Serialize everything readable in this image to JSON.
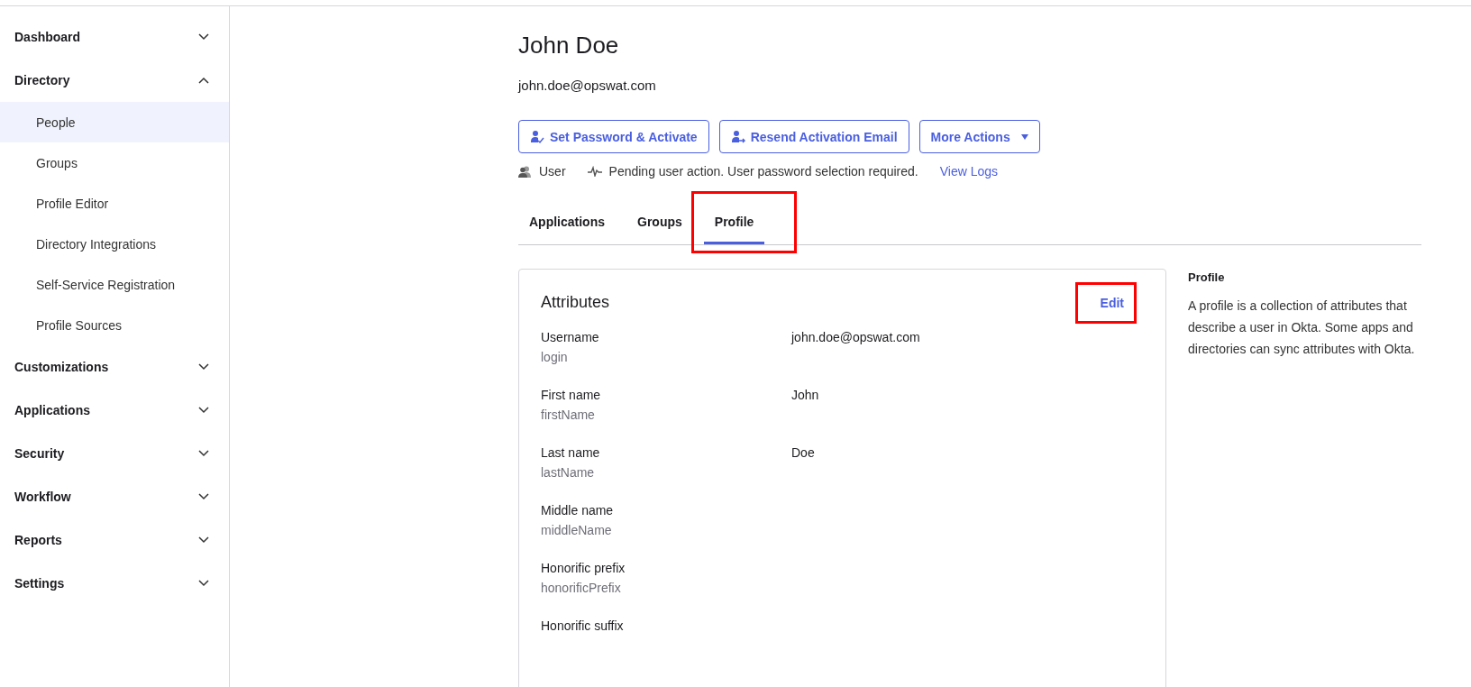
{
  "sidebar": {
    "items": [
      {
        "label": "Dashboard",
        "expanded": false
      },
      {
        "label": "Directory",
        "expanded": true,
        "children": [
          {
            "label": "People",
            "selected": true
          },
          {
            "label": "Groups",
            "selected": false
          },
          {
            "label": "Profile Editor",
            "selected": false
          },
          {
            "label": "Directory Integrations",
            "selected": false
          },
          {
            "label": "Self-Service Registration",
            "selected": false
          },
          {
            "label": "Profile Sources",
            "selected": false
          }
        ]
      },
      {
        "label": "Customizations",
        "expanded": false
      },
      {
        "label": "Applications",
        "expanded": false
      },
      {
        "label": "Security",
        "expanded": false
      },
      {
        "label": "Workflow",
        "expanded": false
      },
      {
        "label": "Reports",
        "expanded": false
      },
      {
        "label": "Settings",
        "expanded": false
      }
    ]
  },
  "profile": {
    "name": "John Doe",
    "email": "john.doe@opswat.com"
  },
  "actions": [
    {
      "label": "Set Password & Activate",
      "kind": "set-password"
    },
    {
      "label": "Resend Activation Email",
      "kind": "resend"
    },
    {
      "label": "More Actions",
      "kind": "dropdown"
    }
  ],
  "status": {
    "role": "User",
    "message": "Pending user action. User password selection required.",
    "link": "View Logs"
  },
  "tabs": [
    {
      "label": "Applications",
      "selected": false,
      "highlighted": false
    },
    {
      "label": "Groups",
      "selected": false,
      "highlighted": false
    },
    {
      "label": "Profile",
      "selected": true,
      "highlighted": true
    }
  ],
  "attributes": {
    "title": "Attributes",
    "edit": {
      "label": "Edit",
      "highlighted": true
    },
    "rows": [
      {
        "label": "Username",
        "key": "login",
        "value": "john.doe@opswat.com"
      },
      {
        "label": "First name",
        "key": "firstName",
        "value": "John"
      },
      {
        "label": "Last name",
        "key": "lastName",
        "value": "Doe"
      },
      {
        "label": "Middle name",
        "key": "middleName"
      },
      {
        "label": "Honorific prefix",
        "key": "honorificPrefix"
      },
      {
        "label": "Honorific suffix"
      }
    ]
  },
  "help": {
    "title": "Profile",
    "text": "A profile is a collection of attributes that describe a user in Okta. Some apps and directories can sync attributes with Okta."
  }
}
